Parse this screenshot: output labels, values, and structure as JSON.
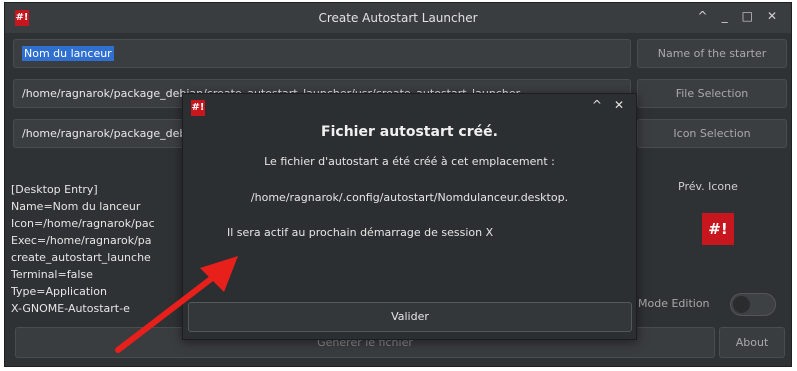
{
  "window": {
    "title": "Create Autostart Launcher",
    "logo_text": "#!",
    "controls": [
      "^",
      "_",
      "□",
      "✕"
    ]
  },
  "form": {
    "name_value": "Nom du lanceur",
    "file_value": "/home/ragnarok/package_debian/create_autostart_launcher/usr/create_autostart_launcher",
    "icon_value": "/home/ragnarok/package_debian/create_autostart_launcher/usr/share/icons"
  },
  "side_buttons": {
    "name_of_starter": "Name of the starter",
    "file_selection": "File Selection",
    "icon_selection": "Icon Selection"
  },
  "preview_text": "[Desktop Entry]\nName=Nom du lanceur\nIcon=/home/ragnarok/pac\nExec=/home/ragnarok/pa\ncreate_autostart_launche\nTerminal=false\nType=Application\nX-GNOME-Autostart-e",
  "icon_preview": {
    "label": "Prév. Icone",
    "glyph": "#!"
  },
  "mode_edition_label": "Mode Edition",
  "mode_edition_on": false,
  "bottom": {
    "generate_label": "Générer le fichier",
    "about_label": "About"
  },
  "dialog": {
    "logo_text": "#!",
    "controls": [
      "^",
      "✕"
    ],
    "title": "Fichier autostart créé.",
    "line1": "Le fichier d'autostart a été créé à cet emplacement :",
    "path": "/home/ragnarok/.config/autostart/Nomdulanceur.desktop.",
    "line3": "Il sera actif au prochain démarrage de session X",
    "ok_label": "Valider"
  },
  "annotation": {
    "arrow_color": "#e8201c"
  },
  "colors": {
    "window_bg": "#2f3234",
    "selection": "#2f6fd0",
    "brand_red": "#c8161e"
  }
}
